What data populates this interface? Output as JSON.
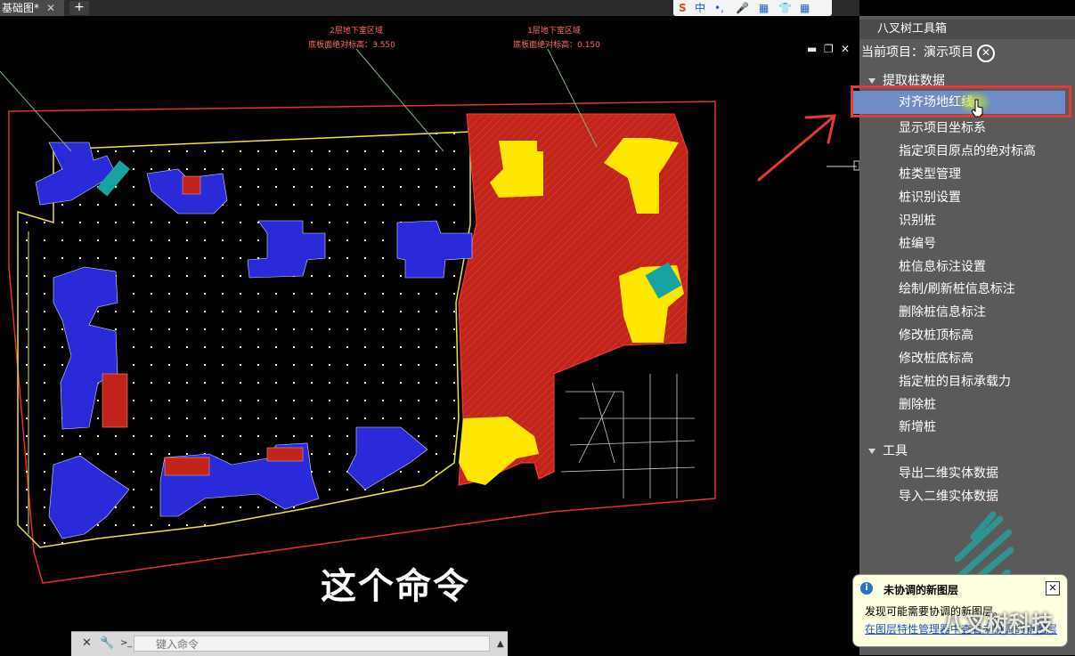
{
  "tab": {
    "title": "基础图*",
    "close": "✕",
    "add": "+"
  },
  "ime": {
    "items": [
      "S",
      "中",
      "•,",
      "🎤",
      "▦",
      "👕",
      "▦"
    ]
  },
  "drawing": {
    "region2_title": "2层地下室区域",
    "region2_value": "底板面绝对标高：3.550",
    "region1_title": "1层地下室区域",
    "region1_value": "底板面绝对标高：0.150"
  },
  "canvas_controls": {
    "minimize": "▬",
    "restore": "❐",
    "close": "✕"
  },
  "caption": "这个命令",
  "cmdline": {
    "close": "✕",
    "wrench": "🔧",
    "prompt": ">_",
    "placeholder": "键入命令",
    "arrow": "▲"
  },
  "panel": {
    "title": "八叉树工具箱",
    "project_label": "当前项目：",
    "project_value": "演示项目",
    "project_close": "✕",
    "groups": [
      {
        "label": "提取桩数据",
        "items": [
          "对齐场地红线",
          "显示项目坐标系",
          "指定项目原点的绝对标高",
          "桩类型管理",
          "桩识别设置",
          "识别桩",
          "桩编号",
          "桩信息标注设置",
          "绘制/刷新桩信息标注",
          "删除桩信息标注",
          "修改桩顶标高",
          "修改桩底标高",
          "指定桩的目标承载力",
          "删除桩",
          "新增桩"
        ]
      },
      {
        "label": "工具",
        "items": [
          "导出二维实体数据",
          "导入二维实体数据"
        ]
      }
    ]
  },
  "notification": {
    "icon": "i",
    "title": "未协调的新图层",
    "body": "发现可能需要协调的新图层。",
    "link": "在图层特性管理器中查看未协调的新图层",
    "close": "✕"
  },
  "watermark": "八叉树科技",
  "colors": {
    "panel_bg": "#5a5a5a",
    "selected": "#6f8cc6",
    "highlight_box": "#e53935",
    "fill_red": "#c0241b",
    "fill_yellow": "#ffe600",
    "building_blue": "#2a2ad8"
  }
}
